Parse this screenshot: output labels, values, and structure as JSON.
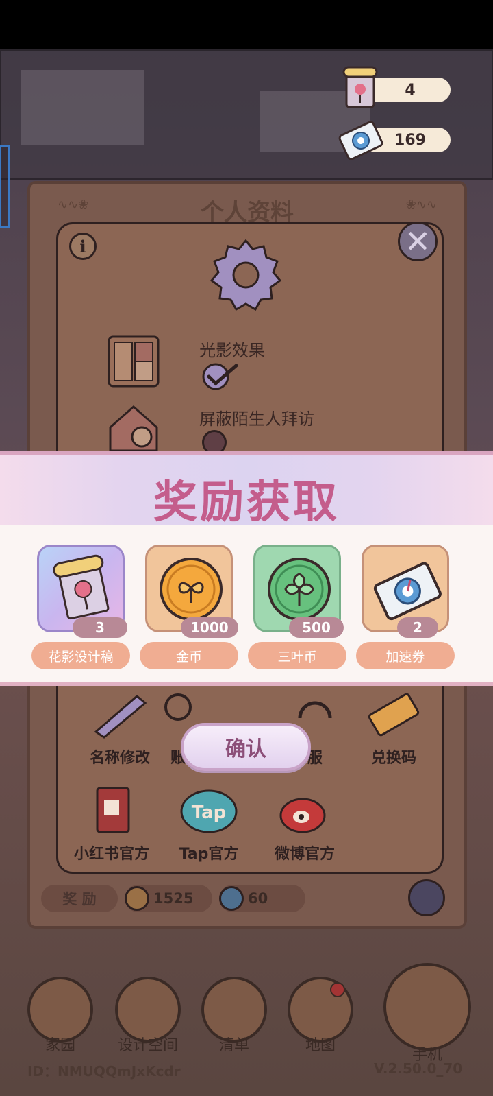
{
  "status": {
    "design_draft_count": "4",
    "speed_ticket_count": "169"
  },
  "profile": {
    "title": "个人资料",
    "settings": [
      {
        "label": "光影效果"
      },
      {
        "label": "屏蔽陌生人拜访"
      }
    ],
    "options": [
      {
        "label": "名称修改",
        "icon": "pencil-icon"
      },
      {
        "label": "账",
        "icon": "account-icon"
      },
      {
        "label": "服",
        "icon": "headset-icon"
      },
      {
        "label": "兑换码",
        "icon": "ticket-icon"
      },
      {
        "label": "小红书官方",
        "icon": "red-book-icon"
      },
      {
        "label": "Tap官方",
        "icon": "tap-icon"
      },
      {
        "label": "微博官方",
        "icon": "weibo-icon"
      }
    ],
    "reward_label": "奖 励",
    "coins": "1525",
    "clovers": "60"
  },
  "nav": {
    "items": [
      {
        "label": "家园"
      },
      {
        "label": "设计空间"
      },
      {
        "label": "清单"
      },
      {
        "label": "地图"
      },
      {
        "label": "手机"
      }
    ],
    "user_id": "ID：NMUQQmJxKcdr",
    "version": "V.2.50.0_70"
  },
  "reward": {
    "title": "奖励获取",
    "items": [
      {
        "name": "花影设计稿",
        "count": "3",
        "icon": "design-draft-icon"
      },
      {
        "name": "金币",
        "count": "1000",
        "icon": "gold-coin-icon"
      },
      {
        "name": "三叶币",
        "count": "500",
        "icon": "clover-coin-icon"
      },
      {
        "name": "加速券",
        "count": "2",
        "icon": "speed-ticket-icon"
      }
    ],
    "confirm_label": "确认"
  },
  "colors": {
    "title_pink": "#c45d8c",
    "name_pill": "#f0ad92",
    "count_pill": "#b88996"
  }
}
